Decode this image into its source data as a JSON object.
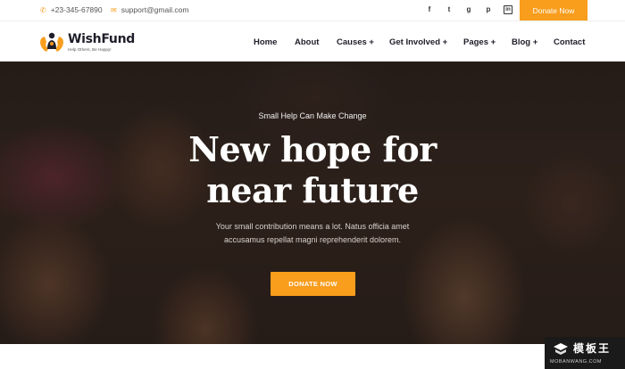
{
  "topbar": {
    "phone": "+23-345-67890",
    "email": "support@gmail.com",
    "social_icons": [
      "facebook-icon",
      "twitter-icon",
      "google-plus-icon",
      "pinterest-icon",
      "linkedin-icon"
    ],
    "social_glyphs": [
      "f",
      "t",
      "g",
      "p",
      "in"
    ],
    "donate_label": "Donate Now"
  },
  "header": {
    "brand": "WishFund",
    "tagline": "Help Others, Be Happy!",
    "nav": [
      "Home",
      "About",
      "Causes +",
      "Get Involved +",
      "Pages +",
      "Blog +",
      "Contact"
    ]
  },
  "hero": {
    "kicker": "Small Help Can Make Change",
    "headline_line1": "New hope for",
    "headline_line2": "near future",
    "desc_line1": "Your small contribution means a lot. Natus officia amet",
    "desc_line2": "accusamus repellat magni reprehenderit dolorem.",
    "cta_label": "DONATE NOW"
  },
  "watermark": {
    "cn": "模板王",
    "en": "MOBANWANG.COM"
  },
  "colors": {
    "accent": "#f89d1c",
    "dark": "#1e1e2a"
  }
}
